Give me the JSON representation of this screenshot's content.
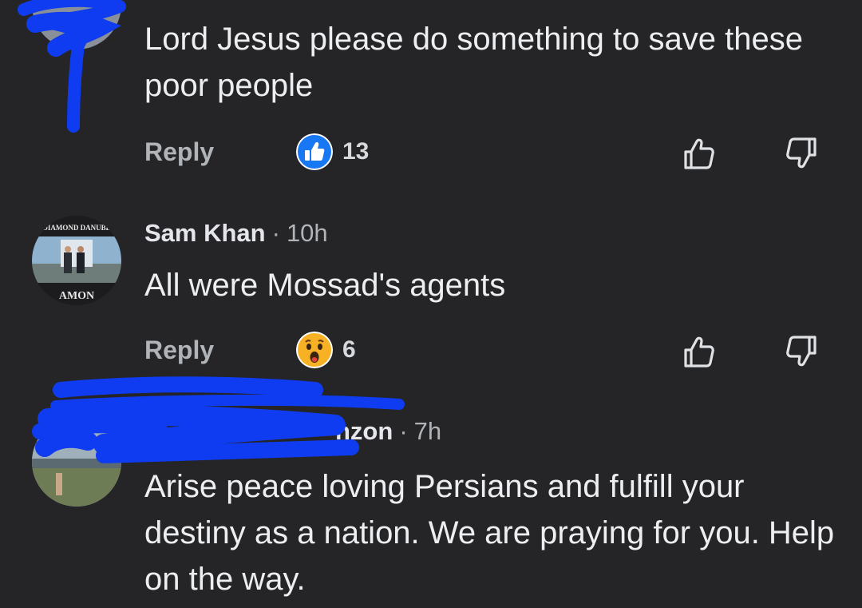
{
  "comments": [
    {
      "author": "",
      "time": "",
      "text": "Lord Jesus please do something to save these poor people",
      "reply_label": "Reply",
      "reaction": {
        "icon": "like-reaction-icon",
        "count": "13"
      }
    },
    {
      "author": "Sam Khan",
      "time": "10h",
      "avatar_text_top": "DIAMOND DANUBE",
      "avatar_text_bottom": "AMON",
      "text": "All were Mossad's agents",
      "reply_label": "Reply",
      "reaction": {
        "icon": "wow-reaction-icon",
        "count": "6"
      }
    },
    {
      "author": "nzon",
      "time": "7h",
      "text": "Arise peace loving Persians and fulfill your destiny as a nation. We are praying for you. Help on the way."
    }
  ],
  "separator": "·",
  "colors": {
    "background": "#252527",
    "text": "#e4e6eb",
    "muted": "#b0b3b8",
    "like_blue": "#1877f2",
    "redaction_blue": "#0f3cf0"
  }
}
